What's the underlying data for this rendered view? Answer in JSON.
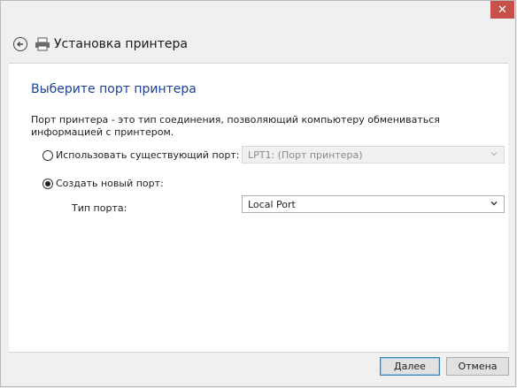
{
  "titlebar": {
    "close_glyph": "✕"
  },
  "header": {
    "title": "Установка принтера",
    "back_icon": "back-arrow-icon",
    "printer_icon": "printer-icon"
  },
  "main": {
    "heading": "Выберите порт принтера",
    "description": "Порт принтера - это тип соединения, позволяющий компьютеру обмениваться информацией с принтером.",
    "use_existing": {
      "label": "Использовать существующий порт:",
      "selected": false,
      "value": "LPT1: (Порт принтера)",
      "enabled": false
    },
    "create_new": {
      "label": "Создать новый порт:",
      "selected": true
    },
    "port_type": {
      "label": "Тип порта:",
      "value": "Local Port"
    }
  },
  "footer": {
    "next_label": "Далее",
    "cancel_label": "Отмена"
  },
  "colors": {
    "heading": "#1b3f9f",
    "close": "#c7504b",
    "primary_border": "#3c7fb1"
  }
}
